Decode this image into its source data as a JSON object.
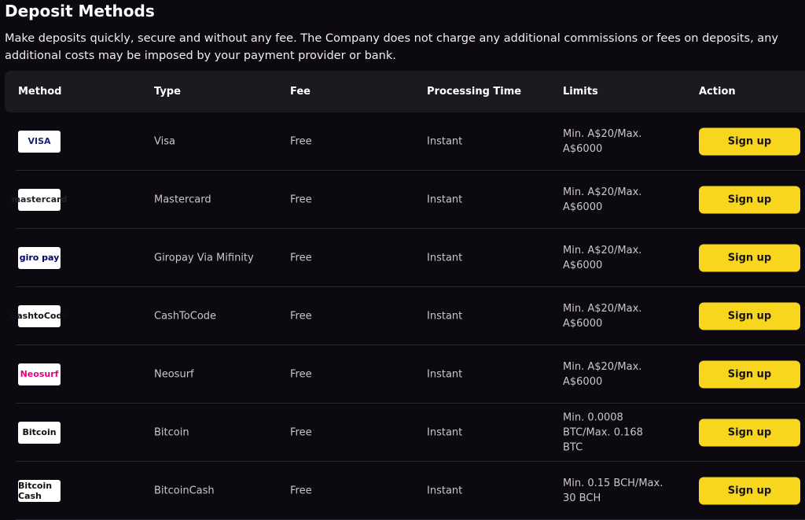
{
  "page": {
    "title": "Deposit Methods",
    "description": "Make deposits quickly, secure and without any fee. The Company does not charge any additional commissions or fees on deposits, any additional costs may be imposed by your payment provider or bank."
  },
  "table": {
    "headers": {
      "method": "Method",
      "type": "Type",
      "fee": "Fee",
      "processing": "Processing Time",
      "limits": "Limits",
      "action": "Action"
    },
    "rows": [
      {
        "logo_text": "VISA",
        "logo_color": "#1a1f71",
        "type": "Visa",
        "fee": "Free",
        "processing": "Instant",
        "limits_line1": "Min. A$20/Max.",
        "limits_line2": "A$6000",
        "action": "Sign up"
      },
      {
        "logo_text": "mastercard",
        "logo_color": "#222222",
        "type": "Mastercard",
        "fee": "Free",
        "processing": "Instant",
        "limits_line1": "Min. A$20/Max.",
        "limits_line2": "A$6000",
        "action": "Sign up"
      },
      {
        "logo_text": "giro pay",
        "logo_color": "#000268",
        "type": "Giropay Via Mifinity",
        "fee": "Free",
        "processing": "Instant",
        "limits_line1": "Min. A$20/Max.",
        "limits_line2": "A$6000",
        "action": "Sign up"
      },
      {
        "logo_text": "CashtoCode",
        "logo_color": "#111111",
        "type": "CashToCode",
        "fee": "Free",
        "processing": "Instant",
        "limits_line1": "Min. A$20/Max.",
        "limits_line2": "A$6000",
        "action": "Sign up"
      },
      {
        "logo_text": "Neosurf",
        "logo_color": "#e6007e",
        "type": "Neosurf",
        "fee": "Free",
        "processing": "Instant",
        "limits_line1": "Min. A$20/Max.",
        "limits_line2": "A$6000",
        "action": "Sign up"
      },
      {
        "logo_text": "Bitcoin",
        "logo_color": "#111111",
        "type": "Bitcoin",
        "fee": "Free",
        "processing": "Instant",
        "limits_line1": "Min. 0.0008",
        "limits_line2": "BTC/Max. 0.168 BTC",
        "action": "Sign up"
      },
      {
        "logo_text": "Bitcoin Cash",
        "logo_color": "#111111",
        "type": "BitcoinCash",
        "fee": "Free",
        "processing": "Instant",
        "limits_line1": "Min. 0.15 BCH/Max.",
        "limits_line2": "30 BCH",
        "action": "Sign up"
      }
    ]
  },
  "colors": {
    "accent": "#f8d61e",
    "background": "#0d0910",
    "header_bg": "#1c1a20"
  }
}
